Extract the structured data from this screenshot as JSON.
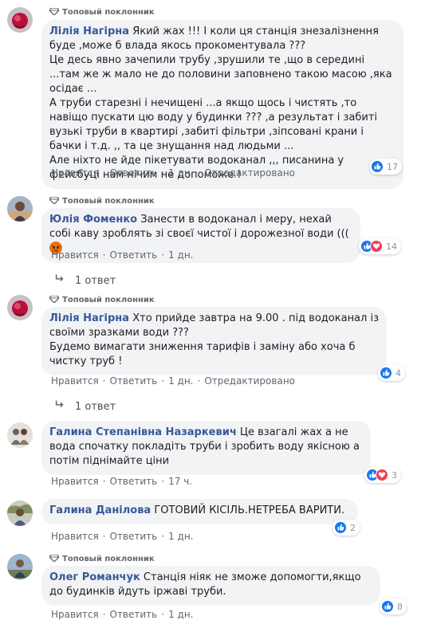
{
  "badge_label": "Топовый поклонник",
  "actions": {
    "like": "Нравится",
    "reply": "Ответить",
    "edited": "Отредактировано"
  },
  "colors": {
    "link": "#385898",
    "bubble": "#f2f3f5",
    "like_blue": "#1877f2",
    "love_red": "#f33e58"
  },
  "comments": [
    {
      "author": "Лілія Нагірна",
      "text": "Який жах !!! І коли ця станція знезалізнення буде ,може б влада якось прокоментувала ???\nЦе десь явно зачепили трубу ,зрушили те ,що в середині ...там же ж мало не до половини заповнено такою масою ,яка осідає ...\nА труби старезні і нечищені ...а якщо щось і чистять ,то навіщо пускати цю воду у будинки ??? ,а результат і забиті вузькі труби в квартирі ,забиті фільтри ,зіпсовані крани і бачки і т.д. ,, та це знущання над людьми ...\nАле ніхто не йде пікетувати водоканал ,,, писанина у фейсбуці нам нічим не допоможе !",
      "time": "1 дн.",
      "edited": true,
      "reactions": {
        "icons": [
          "like-icon"
        ],
        "count": "17"
      }
    },
    {
      "author": "Юлія Фоменко",
      "text": "Занести в водоканал і меру, нехай собі каву зроблять зі своєї чистої і дорожезної води (((",
      "emoji": "angry-face-icon",
      "time": "1 дн.",
      "edited": false,
      "reactions": {
        "icons": [
          "like-icon",
          "love-icon"
        ],
        "count": "14"
      },
      "replies": "1 ответ"
    },
    {
      "author": "Лілія Нагірна",
      "text": "Хто прийде завтра на 9.00 . під водоканал із своїми зразками води ???\nБудемо вимагати зниження тарифів і заміну або хоча б чистку труб !",
      "time": "1 дн.",
      "edited": true,
      "reactions": {
        "icons": [
          "like-icon"
        ],
        "count": "4"
      },
      "replies": "1 ответ"
    },
    {
      "author": "Галина Степанівна Назаркевич",
      "text": "Це взагалі жах а не вода спочатку покладіть труби і зробить воду якісною а потім піднімайте ціни",
      "time": "17 ч.",
      "edited": false,
      "reactions": {
        "icons": [
          "like-icon",
          "love-icon"
        ],
        "count": "3"
      }
    },
    {
      "author": "Галина Данілова",
      "text": "ГОТОВИЙ КІСІЛЬ.НЕТРЕБА ВАРИТИ.",
      "time": "1 дн.",
      "edited": false,
      "reactions": {
        "icons": [
          "like-icon"
        ],
        "count": "2"
      }
    },
    {
      "author": "Олег Романчук",
      "text": "Станція ніяк не зможе допомогти,якщо до будинків йдуть іржаві труби.",
      "time": "1 дн.",
      "edited": false,
      "reactions": {
        "icons": [
          "like-icon"
        ],
        "count": "8"
      }
    }
  ]
}
